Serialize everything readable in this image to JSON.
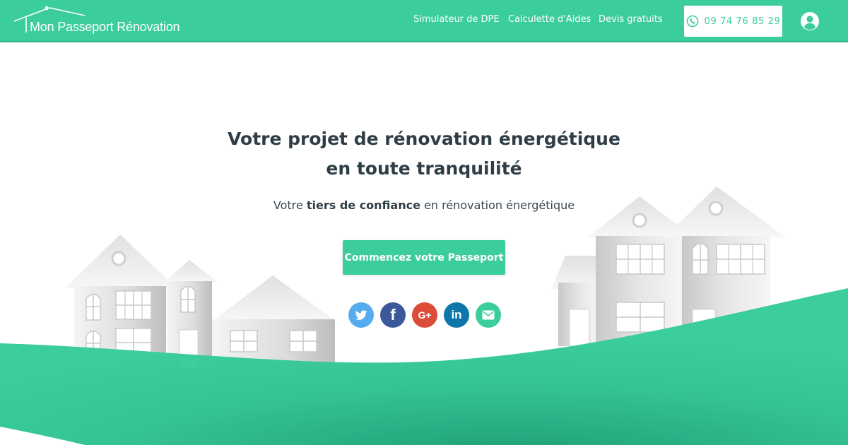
{
  "brand": {
    "name": "Mon Passeport Rénovation"
  },
  "nav": {
    "items": [
      {
        "label": "Simulateur de DPE"
      },
      {
        "label": "Calculette d'Aides"
      },
      {
        "label": "Devis gratuits"
      }
    ],
    "phone": "09 74 76 85 29"
  },
  "hero": {
    "title_line1": "Votre projet de rénovation énergétique",
    "title_line2": "en toute tranquilité",
    "sub_before": "Votre",
    "sub_bold": "tiers de confiance",
    "sub_after": "en rénovation énergétique",
    "cta_label": "Commencez votre Passeport"
  },
  "social": [
    {
      "name": "twitter-icon",
      "glyph": ""
    },
    {
      "name": "facebook-icon",
      "glyph": "f"
    },
    {
      "name": "google-plus-icon",
      "glyph": "G+"
    },
    {
      "name": "linkedin-icon",
      "glyph": "in"
    },
    {
      "name": "email-icon",
      "glyph": ""
    }
  ],
  "colors": {
    "brand_green": "#3ccd9c",
    "twitter": "#55acee",
    "facebook": "#3b5998",
    "google_plus": "#dd4b39",
    "linkedin": "#0e76a8",
    "title_text": "#2f3e46"
  }
}
